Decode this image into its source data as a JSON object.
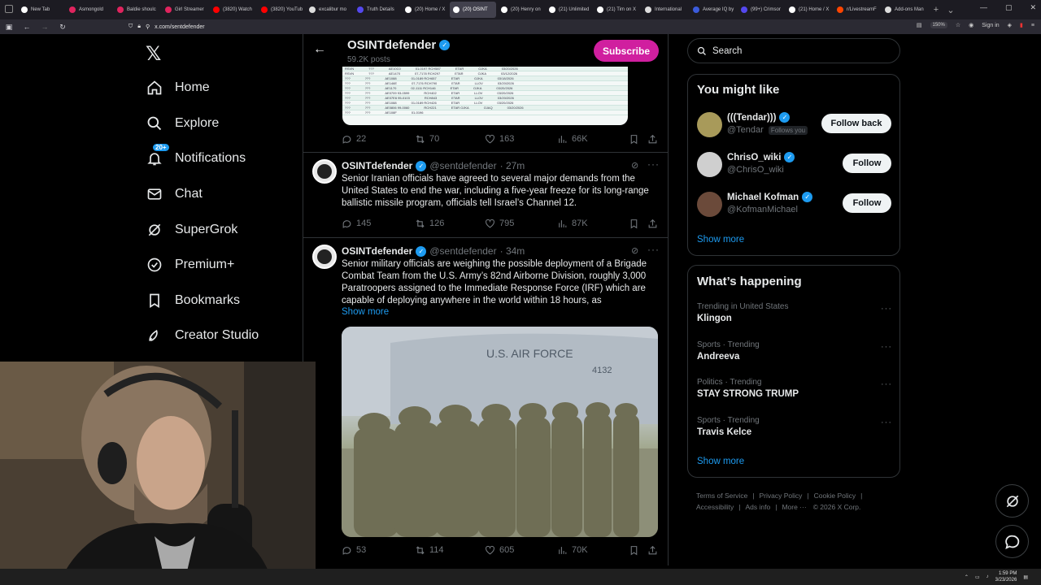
{
  "browser": {
    "tabs": [
      {
        "label": "New Tab",
        "color": "#ffffff"
      },
      {
        "label": "Asmongold",
        "color": "#e0245e"
      },
      {
        "label": "Baldie shoulc",
        "color": "#e0245e"
      },
      {
        "label": "Girl Streamer",
        "color": "#e0245e"
      },
      {
        "label": "(3820) Watch",
        "color": "#ff0000"
      },
      {
        "label": "(3820) YouTub",
        "color": "#ff0000"
      },
      {
        "label": "excalibur mo",
        "color": "#dddddd"
      },
      {
        "label": "Truth Details",
        "color": "#5448ee"
      },
      {
        "label": "(20) Home / X",
        "color": "#ffffff"
      },
      {
        "label": "(20) OSINT",
        "color": "#ffffff"
      },
      {
        "label": "(20) Henry on",
        "color": "#ffffff"
      },
      {
        "label": "(21) Unlimited",
        "color": "#ffffff"
      },
      {
        "label": "(21) Tim on X",
        "color": "#ffffff"
      },
      {
        "label": "International",
        "color": "#dddddd"
      },
      {
        "label": "Average IQ by",
        "color": "#3b5bdb"
      },
      {
        "label": "(99+) Crimsor",
        "color": "#5448ee"
      },
      {
        "label": "(21) Home / X",
        "color": "#ffffff"
      },
      {
        "label": "r/LivestreamF",
        "color": "#ff4500"
      },
      {
        "label": "Add-ons Man",
        "color": "#dddddd"
      }
    ],
    "url": "x.com/sentdefender",
    "zoom": "150%",
    "sign_in": "Sign in"
  },
  "sidebar": {
    "items": [
      {
        "label": "Home",
        "icon": "home-icon"
      },
      {
        "label": "Explore",
        "icon": "search-icon"
      },
      {
        "label": "Notifications",
        "icon": "bell-icon",
        "badge": "20+"
      },
      {
        "label": "Chat",
        "icon": "mail-icon"
      },
      {
        "label": "SuperGrok",
        "icon": "grok-icon"
      },
      {
        "label": "Premium+",
        "icon": "verified-icon"
      },
      {
        "label": "Bookmarks",
        "icon": "bookmark-icon"
      },
      {
        "label": "Creator Studio",
        "icon": "rocket-icon"
      }
    ]
  },
  "profile_header": {
    "name": "OSINTdefender",
    "posts": "59.2K posts",
    "subscribe": "Subscribe"
  },
  "embedded_table_rows": [
    [
      "RSVN",
      "???",
      "AE10C0",
      "01-0197 RCH587",
      "ETAR",
      "OJKA",
      "03/20/2026"
    ],
    [
      "RSVN",
      "???",
      "AE1470",
      "07-7178 RCH297",
      "ETAR",
      "OJKA",
      "03/12/2026"
    ],
    [
      "???",
      "???",
      "AE1088",
      "01-0189 RCH657",
      "ETAR",
      "OJKA",
      "03/18/2026"
    ],
    [
      "???",
      "???",
      "AE146E",
      "07-7176 RCH790",
      "ETAR",
      "LLOV",
      "03/20/2026"
    ],
    [
      "???",
      "???",
      "AE1170",
      "02-1111 RCH146",
      "ETAR",
      "OJKA",
      "03/20/2026"
    ],
    [
      "???",
      "???",
      "AE0709 93-0599",
      "RCH402",
      "ETAR",
      "LLOV",
      "03/20/2026"
    ],
    [
      "???",
      "???",
      "AE07E6 95-0103",
      "RCH843",
      "ETAR",
      "LLOV",
      "03/20/2026"
    ],
    [
      "???",
      "???",
      "AE1088",
      "01-0189 RCH426",
      "ETAR",
      "LLOV",
      "03/20/2026"
    ],
    [
      "???",
      "???",
      "AE0806 99-0060",
      "RCH221",
      "ETAR OJKA",
      "OJAQ",
      "03/20/2026"
    ],
    [
      "???",
      "???",
      "AE108F",
      "01-0196",
      "",
      "",
      ""
    ]
  ],
  "tweets": [
    {
      "stats": {
        "replies": "22",
        "reposts": "70",
        "likes": "163",
        "views": "66K"
      }
    },
    {
      "name": "OSINTdefender",
      "handle": "@sentdefender",
      "time": "· 27m",
      "text": "Senior Iranian officials have agreed to several major demands from the United States to end the war, including a five-year freeze for its long-range ballistic missile program, officials tell Israel’s Channel 12.",
      "stats": {
        "replies": "145",
        "reposts": "126",
        "likes": "795",
        "views": "87K"
      }
    },
    {
      "name": "OSINTdefender",
      "handle": "@sentdefender",
      "time": "· 34m",
      "text": "Senior military officials are weighing the possible deployment of a Brigade Combat Team from the U.S. Army’s 82nd Airborne Division, roughly 3,000 Paratroopers assigned to the Immediate Response Force (IRF) which are capable of deploying anywhere in the world within 18 hours, as",
      "show_more": "Show more",
      "photo_text": "U.S. AIR FORCE",
      "photo_tail": "4132",
      "stats": {
        "replies": "53",
        "reposts": "114",
        "likes": "605",
        "views": "70K"
      }
    }
  ],
  "right": {
    "search_placeholder": "Search",
    "wtf_title": "You might like",
    "wtf": [
      {
        "name": "(((Tendar)))",
        "handle": "@Tendar",
        "follows_you": "Follows you",
        "button": "Follow back",
        "avatar_color": "#a89a5a"
      },
      {
        "name": "ChrisO_wiki",
        "handle": "@ChrisO_wiki",
        "button": "Follow",
        "avatar_color": "#cfcfcf"
      },
      {
        "name": "Michael Kofman",
        "handle": "@KofmanMichael",
        "button": "Follow",
        "avatar_color": "#6b4a3a"
      }
    ],
    "wtf_show_more": "Show more",
    "happening_title": "What’s happening",
    "trends": [
      {
        "context": "Trending in United States",
        "title": "Klingon"
      },
      {
        "context": "Sports · Trending",
        "title": "Andreeva"
      },
      {
        "context": "Politics · Trending",
        "title": "STAY STRONG TRUMP"
      },
      {
        "context": "Sports · Trending",
        "title": "Travis Kelce"
      }
    ],
    "happening_show_more": "Show more",
    "footer": [
      "Terms of Service",
      "Privacy Policy",
      "Cookie Policy",
      "Accessibility",
      "Ads info",
      "More ···",
      "© 2026 X Corp."
    ]
  },
  "taskbar": {
    "time": "1:59 PM",
    "date": "3/23/2026"
  }
}
